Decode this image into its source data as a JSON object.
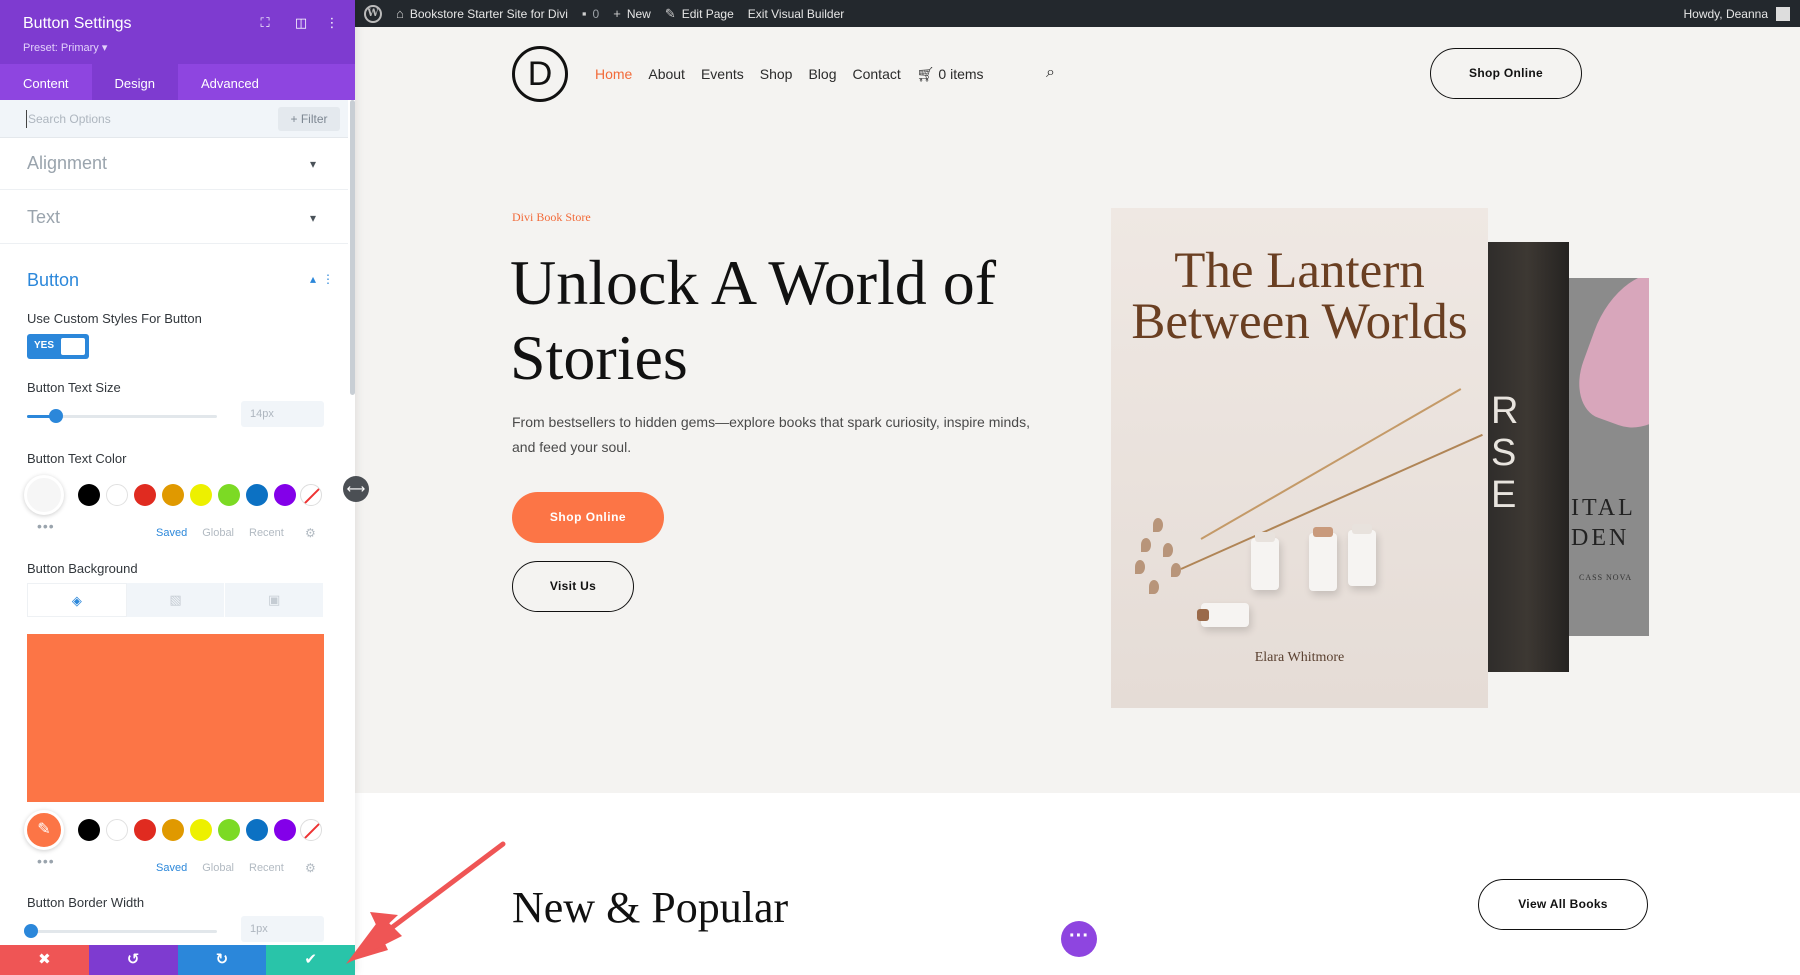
{
  "adminbar": {
    "site_name": "Bookstore Starter Site for Divi",
    "comments": "0",
    "new": "New",
    "edit_page": "Edit Page",
    "exit_builder": "Exit Visual Builder",
    "howdy": "Howdy, Deanna"
  },
  "panel": {
    "title": "Button Settings",
    "preset": "Preset: Primary ▾",
    "tabs": [
      "Content",
      "Design",
      "Advanced"
    ],
    "active_tab": "Design",
    "search_placeholder": "Search Options",
    "filter_label": "+ Filter",
    "sections": {
      "alignment": "Alignment",
      "text": "Text",
      "button": "Button"
    },
    "use_custom_label": "Use Custom Styles For Button",
    "toggle_label": "YES",
    "text_size_label": "Button Text Size",
    "text_size_value": "14px",
    "text_size_fraction": 0.15,
    "text_color_label": "Button Text Color",
    "palette_tabs": [
      "Saved",
      "Global",
      "Recent"
    ],
    "swatches": [
      "#000000",
      "#ffffff",
      "#e02b20",
      "#e09900",
      "#edf000",
      "#7cda24",
      "#0c71c3",
      "#8300e9"
    ],
    "background_label": "Button Background",
    "background_color": "#fc7546",
    "border_width_label": "Button Border Width",
    "border_width_value": "1px",
    "border_width_fraction": 0.02,
    "footer": {
      "cancel": "✖",
      "undo": "↺",
      "redo": "↻",
      "save": "✔"
    }
  },
  "site": {
    "logo_letter": "D",
    "nav": [
      "Home",
      "About",
      "Events",
      "Shop",
      "Blog",
      "Contact"
    ],
    "cart": "0 items",
    "header_cta": "Shop Online",
    "hero": {
      "eyebrow": "Divi Book Store",
      "title": "Unlock A World of Stories",
      "description": "From bestsellers to hidden gems—explore books that spark curiosity, inspire minds, and feed your soul.",
      "primary_cta": "Shop Online",
      "secondary_cta": "Visit Us"
    },
    "books": {
      "main_title": "The Lantern Between Worlds",
      "main_author": "Elara Whitmore",
      "second_text": "R\nS\nE",
      "third_text": "ITAL\nDEN",
      "third_author": "CASS NOVA"
    },
    "section2": {
      "title": "New & Popular",
      "cta": "View All Books"
    }
  },
  "colors": {
    "divi_purple": "#7e3bd0",
    "divi_blue": "#2b87da",
    "accent_orange": "#fc7546",
    "footer_red": "#ef5555",
    "footer_purple": "#7e3bd0",
    "footer_blue": "#2b87da",
    "footer_green": "#29c4a9"
  }
}
